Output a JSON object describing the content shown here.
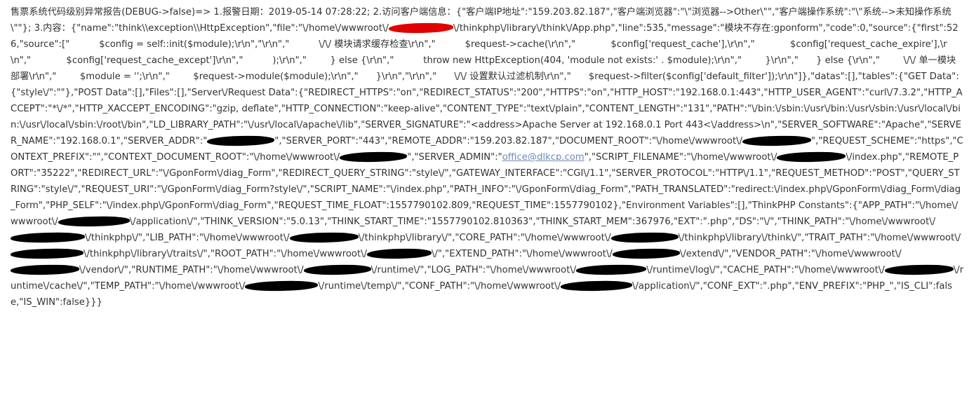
{
  "report": {
    "text": "售票系统代码级别异常报告(DEBUG->false)=> 1.报警日期：2019-05-14 07:28:22; 2.访问客户端信息：{\"客户端IP地址\":\"159.203.82.187\",\"客户端浏览器\":\"\\\"浏览器-->Other\\\"\",\"客户端操作系统\":\"\\\"系统-->未知操作系统\\\"\"}; 3.内容：{\"name\":\"think\\\\exception\\\\HttpException\",\"file\":\"\\/home\\/wwwroot\\/[redacted]\\/thinkphp\\/library\\/think\\/App.php\",\"line\":535,\"message\":\"模块不存在:gponform\",\"code\":0,\"source\":{\"first\":526,\"source\":[\"          $config = self::init($module);\\r\\n\",\"\\r\\n\",\"          \\/\\/ 模块请求缓存检查\\r\\n\",\"          $request->cache(\\r\\n\",\"            $config['request_cache'],\\r\\n\",\"            $config['request_cache_expire'],\\r\\n\",\"            $config['request_cache_except']\\r\\n\",\"          );\\r\\n\",\"        } else {\\r\\n\",\"          throw new HttpException(404, 'module not exists:' . $module);\\r\\n\",\"        }\\r\\n\",\"      } else {\\r\\n\",\"        \\/\\/ 单一模块部署\\r\\n\",\"        $module = '';\\r\\n\",\"        $request->module($module);\\r\\n\",\"      }\\r\\n\",\"\\r\\n\",\"      \\/\\/ 设置默认过滤机制\\r\\n\",\"      $request->filter($config['default_filter']);\\r\\n\"]},\"datas\":[],\"tables\":{\"GET Data\":{\"style\\/\":\"\"},\"POST Data\":[],\"Files\":[],\"Server\\/Request Data\":{\"REDIRECT_HTTPS\":\"on\",\"REDIRECT_STATUS\":\"200\",\"HTTPS\":\"on\",\"HTTP_HOST\":\"192.168.0.1:443\",\"HTTP_USER_AGENT\":\"curl\\/7.3.2\",\"HTTP_ACCEPT\":\"*\\/*\",\"HTTP_XACCEPT_ENCODING\":\"gzip, deflate\",\"HTTP_CONNECTION\":\"keep-alive\",\"CONTENT_TYPE\":\"text\\/plain\",\"CONTENT_LENGTH\":\"131\",\"PATH\":\"\\/bin:\\/sbin:\\/usr\\/bin:\\/usr\\/sbin:\\/usr\\/local\\/bin:\\/usr\\/local\\/sbin:\\/root\\/bin\",\"LD_LIBRARY_PATH\":\"\\/usr\\/local\\/apache\\/lib\",\"SERVER_SIGNATURE\":\"<address>Apache Server at 192.168.0.1 Port 443<\\/address>\\n\",\"SERVER_SOFTWARE\":\"Apache\",\"SERVER_NAME\":\"192.168.0.1\",\"SERVER_ADDR\":\"[redacted]\",\"SERVER_PORT\":\"443\",\"REMOTE_ADDR\":\"159.203.82.187\",\"DOCUMENT_ROOT\":\"\\/home\\/wwwroot\\/[redacted]\",\"REQUEST_SCHEME\":\"https\",\"CONTEXT_PREFIX\":\"\",\"CONTEXT_DOCUMENT_ROOT\":\"\\/home\\/wwwroot\\/[redacted]\",\"SERVER_ADMIN\":\"office@dlkcp.com\",\"SCRIPT_FILENAME\":\"\\/home\\/wwwroot\\/[redacted]\\/index.php\",\"REMOTE_PORT\":\"35222\",\"REDIRECT_URL\":\"\\/GponForm\\/diag_Form\",\"REDIRECT_QUERY_STRING\":\"style\\/\",\"GATEWAY_INTERFACE\":\"CGI\\/1.1\",\"SERVER_PROTOCOL\":\"HTTP\\/1.1\",\"REQUEST_METHOD\":\"POST\",\"QUERY_STRING\":\"style\\/\",\"REQUEST_URI\":\"\\/GponForm\\/diag_Form?style\\/\",\"SCRIPT_NAME\":\"\\/index.php\",\"PATH_INFO\":\"\\/GponForm\\/diag_Form\",\"PATH_TRANSLATED\":\"redirect:\\/index.php\\/GponForm\\/diag_Form\\/diag_Form\",\"PHP_SELF\":\"\\/index.php\\/GponForm\\/diag_Form\",\"REQUEST_TIME_FLOAT\":1557790102.809,\"REQUEST_TIME\":1557790102},\"Environment Variables\":[],\"ThinkPHP Constants\":{\"APP_PATH\":\"\\/home\\/wwwroot\\/[redacted]\\/application\\/\",\"THINK_VERSION\":\"5.0.13\",\"THINK_START_TIME\":\"1557790102.810363\",\"THINK_START_MEM\":367976,\"EXT\":\".php\",\"DS\":\"\\/\",\"THINK_PATH\":\"\\/home\\/wwwroot\\/[redacted]\\/thinkphp\\/\",\"LIB_PATH\":\"\\/home\\/wwwroot\\/[redacted]\\/thinkphp\\/library\\/\",\"CORE_PATH\":\"\\/home\\/wwwroot\\/[redacted]\\/thinkphp\\/library\\/think\\/\",\"TRAIT_PATH\":\"\\/home\\/wwwroot\\/[redacted]\\/thinkphp\\/library\\/traits\\/\",\"ROOT_PATH\":\"\\/home\\/wwwroot\\/[redacted]\\/\",\"EXTEND_PATH\":\"\\/home\\/wwwroot\\/[redacted]\\/extend\\/\",\"VENDOR_PATH\":\"\\/home\\/wwwroot\\/[redacted]\\/vendor\\/\",\"RUNTIME_PATH\":\"\\/home\\/wwwroot\\/[redacted]\\/runtime\\/\",\"LOG_PATH\":\"\\/home\\/wwwroot\\/[redacted]\\/runtime\\/log\\/\",\"CACHE_PATH\":\"\\/home\\/wwwroot\\/[redacted]\\/runtime\\/cache\\/\",\"TEMP_PATH\":\"\\/home\\/wwwroot\\/[redacted]\\/runtime\\/temp\\/\",\"CONF_PATH\":\"\\/home\\/wwwroot\\/[redacted]\\/application\\/\",\"CONF_EXT\":\".php\",\"ENV_PREFIX\":\"PHP_\",\"IS_CLI\":false,\"IS_WIN\":false}}}"
  },
  "colors": {
    "text": "#333333",
    "link": "#6f89b8",
    "redaction": "#000000",
    "redaction_accent": "#e10000",
    "background": "#ffffff"
  }
}
